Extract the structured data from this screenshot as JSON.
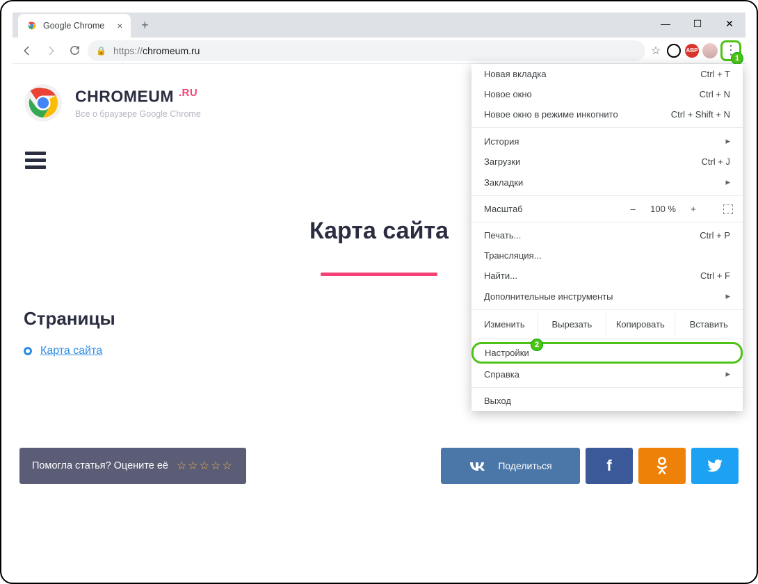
{
  "window": {
    "tab_title": "Google Chrome"
  },
  "toolbar": {
    "url_prefix": "https://",
    "url_host": "chromeum.ru",
    "abp_label": "ABP"
  },
  "site": {
    "brand": "CHROMEUM",
    "brand_suffix": ".RU",
    "tagline": "Все о браузере Google Chrome",
    "page_title": "Карта сайта",
    "section": "Страницы",
    "link": "Карта сайта",
    "rate_prompt": "Помогла статья? Оцените её",
    "share_label": "Поделиться"
  },
  "menu": {
    "new_tab": "Новая вкладка",
    "new_tab_sc": "Ctrl + T",
    "new_window": "Новое окно",
    "new_window_sc": "Ctrl + N",
    "incognito": "Новое окно в режиме инкогнито",
    "incognito_sc": "Ctrl + Shift + N",
    "history": "История",
    "downloads": "Загрузки",
    "downloads_sc": "Ctrl + J",
    "bookmarks": "Закладки",
    "zoom": "Масштаб",
    "zoom_value": "100 %",
    "print": "Печать...",
    "print_sc": "Ctrl + P",
    "cast": "Трансляция...",
    "find": "Найти...",
    "find_sc": "Ctrl + F",
    "more_tools": "Дополнительные инструменты",
    "edit": "Изменить",
    "cut": "Вырезать",
    "copy": "Копировать",
    "paste": "Вставить",
    "settings": "Настройки",
    "help": "Справка",
    "exit": "Выход"
  },
  "badges": {
    "one": "1",
    "two": "2"
  }
}
